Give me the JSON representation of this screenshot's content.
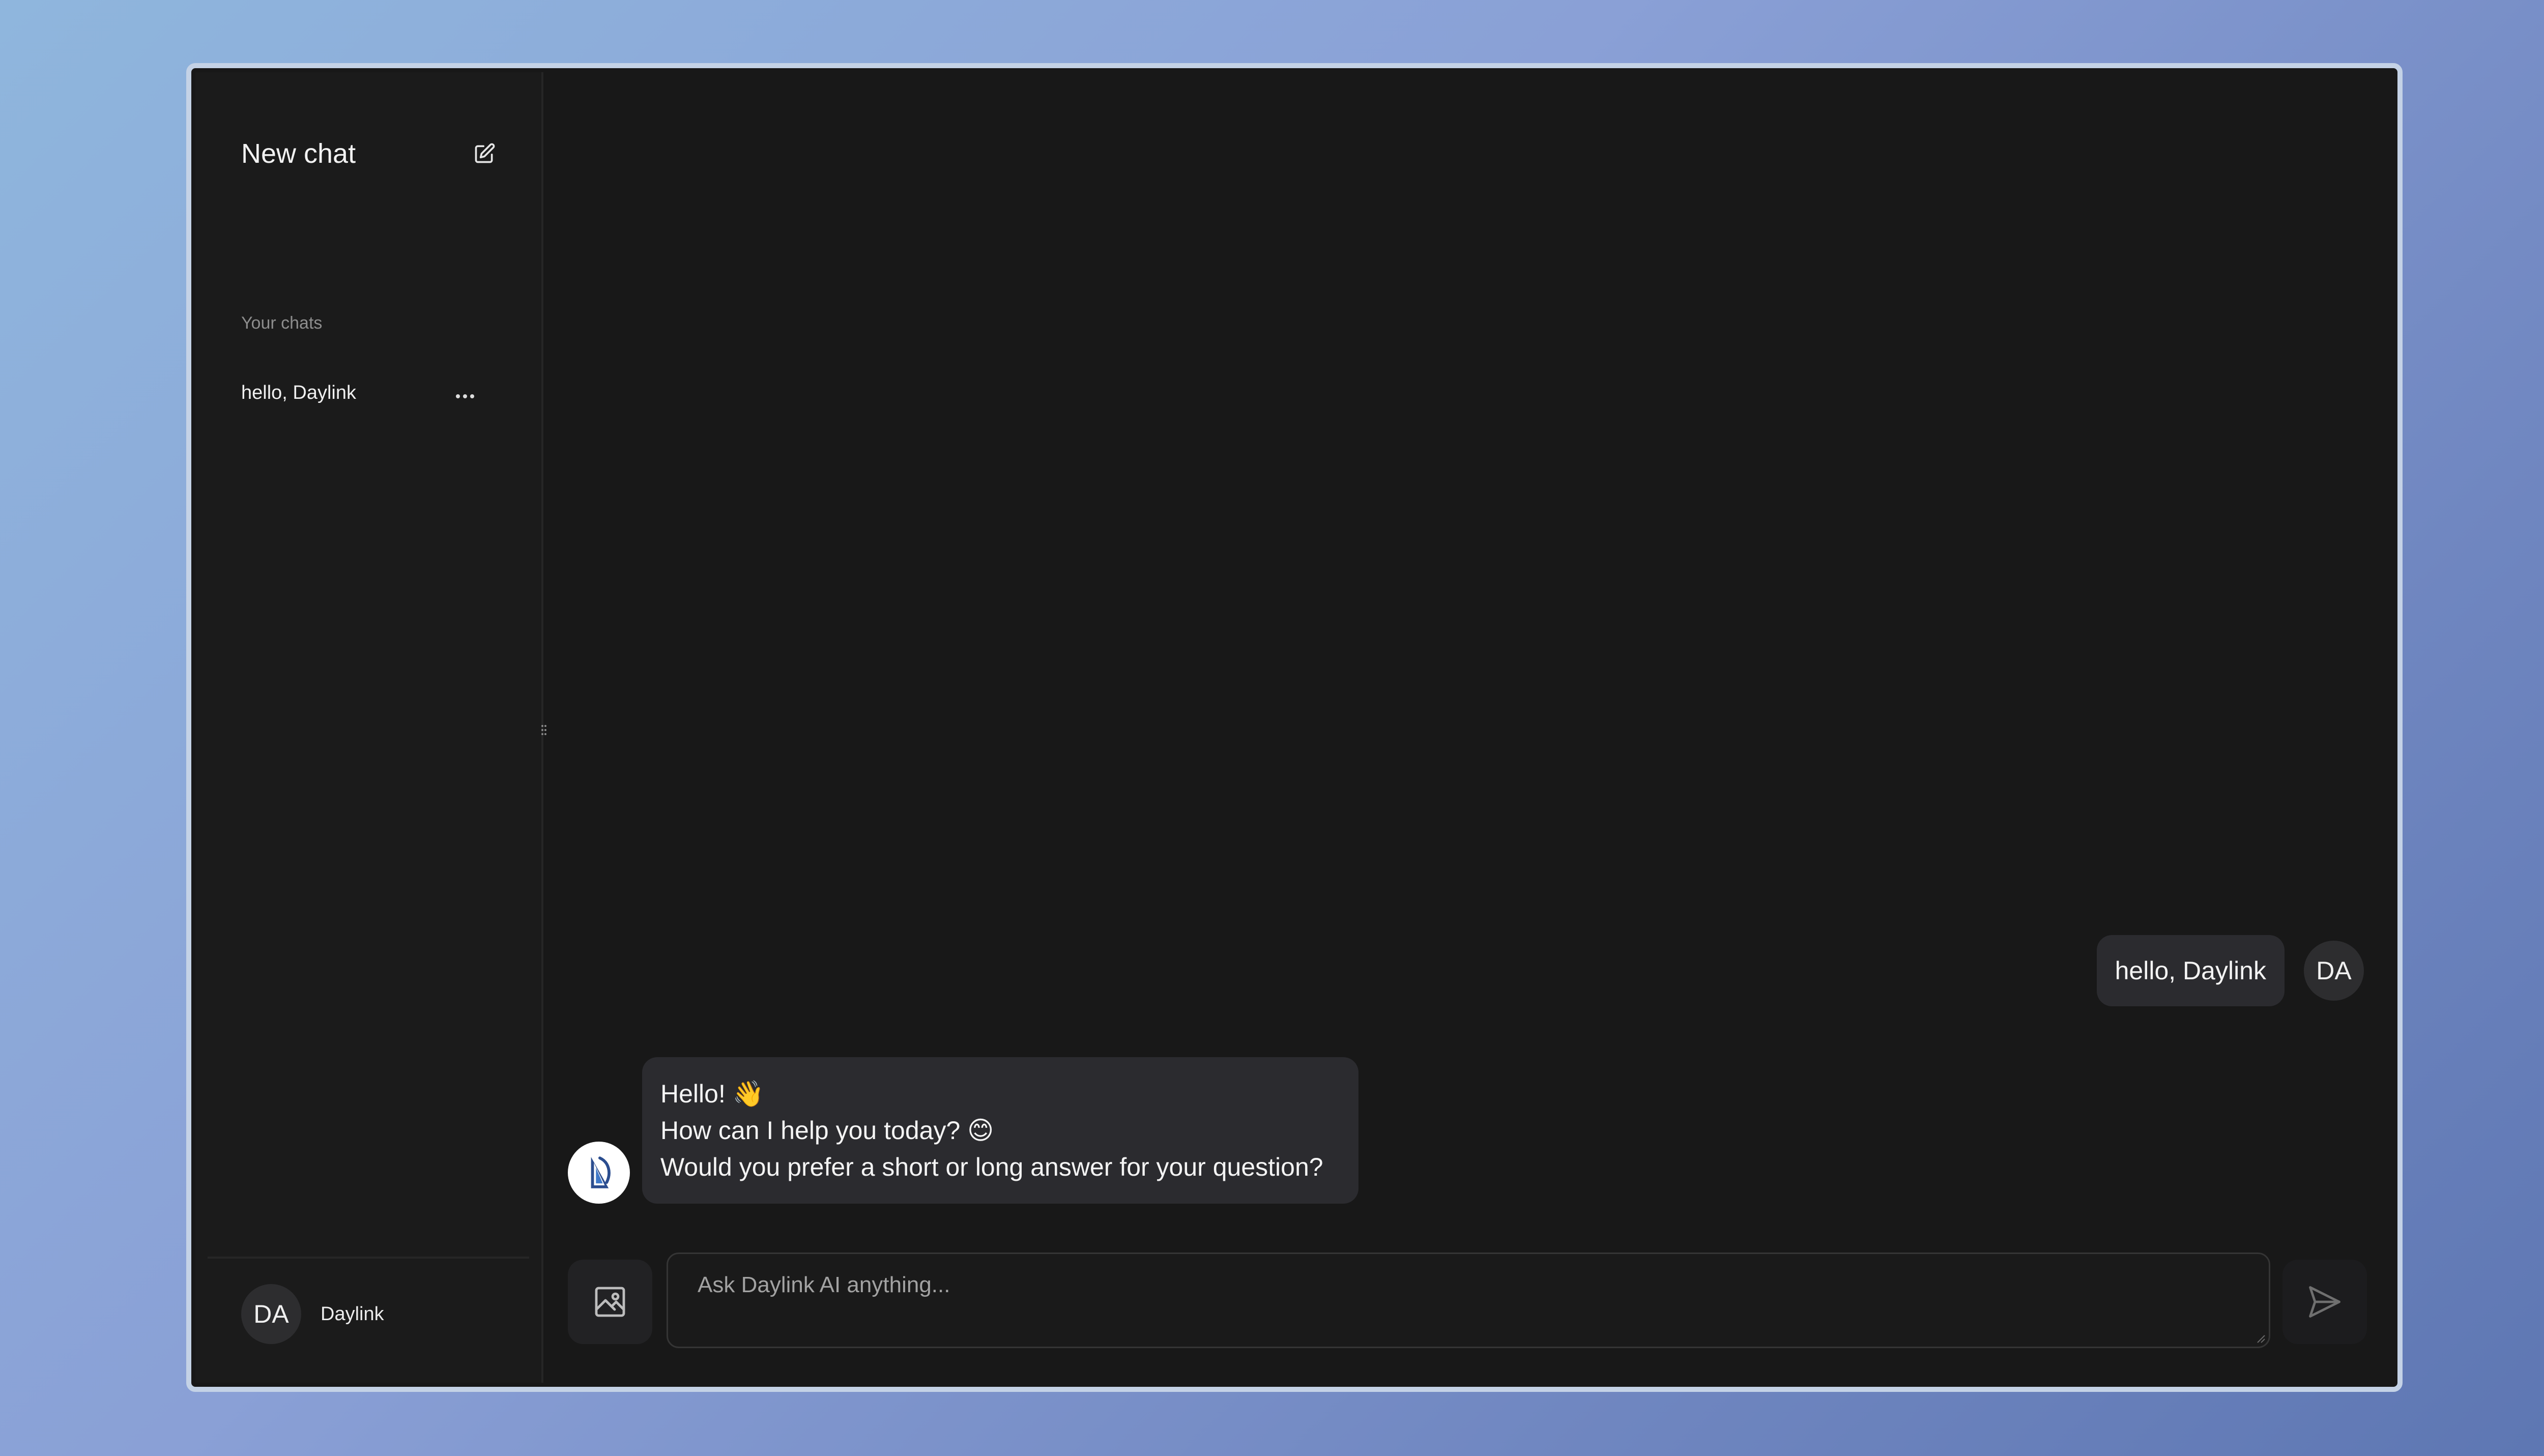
{
  "sidebar": {
    "title": "New chat",
    "section_label": "Your chats",
    "chats": [
      {
        "label": "hello, Daylink",
        "menu_label": "···"
      }
    ],
    "footer": {
      "avatar_initials": "DA",
      "user_name": "Daylink"
    }
  },
  "conversation": {
    "messages": [
      {
        "role": "user",
        "avatar_initials": "DA",
        "text": "hello, Daylink"
      },
      {
        "role": "assistant",
        "lines": [
          "Hello! 👋",
          "How can I help you today? 😊",
          "Would you prefer a short or long answer for your question?"
        ]
      }
    ]
  },
  "composer": {
    "placeholder": "Ask Daylink AI anything..."
  },
  "icons": {
    "new_chat": "edit-icon",
    "chat_menu": "more-horizontal-icon",
    "resize_grip": "drag-handle-icon",
    "attach_image": "image-icon",
    "send": "send-icon",
    "assistant_logo": "daylink-logo"
  },
  "colors": {
    "background": "#181818",
    "bubble": "#2b2b2f",
    "window_border": "#c4d2e6"
  }
}
